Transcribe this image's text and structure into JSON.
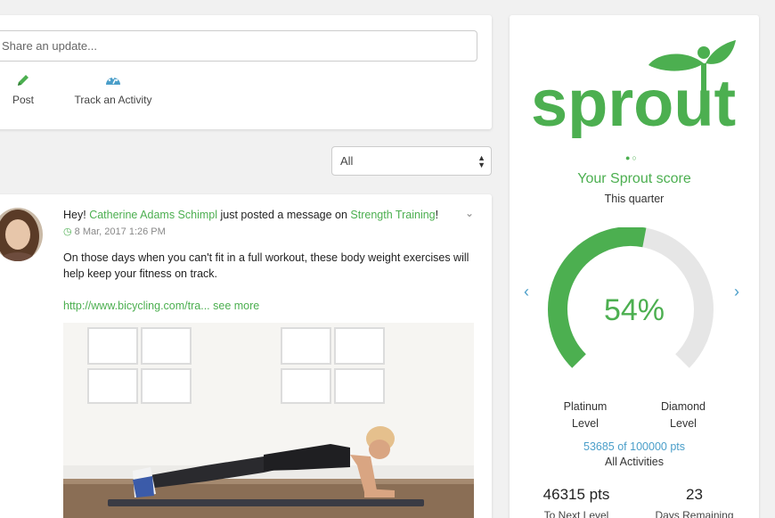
{
  "composer": {
    "placeholder": "Share an update...",
    "actions": [
      {
        "label": "Post",
        "icon": "pencil-icon"
      },
      {
        "label": "Track an Activity",
        "icon": "dashboard-icon"
      }
    ]
  },
  "filter": {
    "selected": "All"
  },
  "post": {
    "prefix": "Hey! ",
    "author": "Catherine Adams Schimpl",
    "middle": " just posted a message on ",
    "group": "Strength Training",
    "suffix": "!",
    "timestamp": "8 Mar, 2017 1:26 PM",
    "body": "On those days when you can't fit in a full workout, these body weight exercises will help keep your fitness on track.",
    "link": "http://www.bicycling.com/tra...",
    "see_more": "see more"
  },
  "sprout": {
    "logo_text": "sprout",
    "score_title": "Your Sprout score",
    "period": "This quarter",
    "percent_label": "54%",
    "percent_value": 54,
    "left_level_line1": "Platinum",
    "left_level_line2": "Level",
    "right_level_line1": "Diamond",
    "right_level_line2": "Level",
    "points_progress": "53685 of 100000 pts",
    "points_scope": "All Activities",
    "to_next_value": "46315 pts",
    "to_next_label": "To Next Level",
    "days_value": "23",
    "days_label": "Days Remaining"
  },
  "colors": {
    "brand_green": "#4caf50",
    "link_blue": "#4a9ec9",
    "gauge_track": "#e6e6e6"
  }
}
